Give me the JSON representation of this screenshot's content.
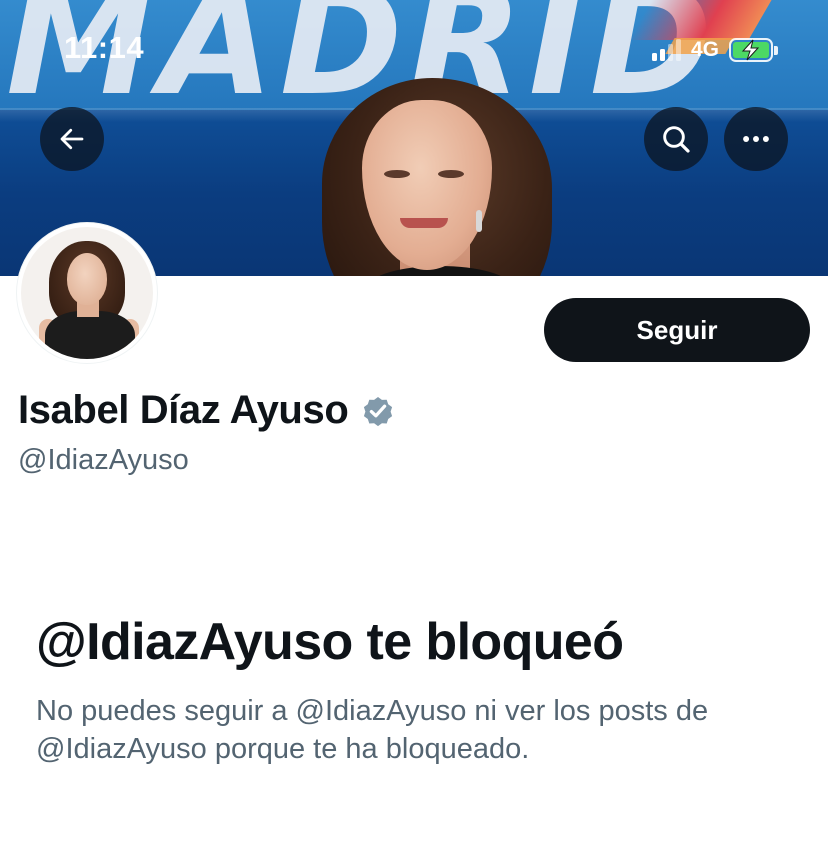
{
  "status_bar": {
    "time": "11:14",
    "network": "4G",
    "signal_bars_active": 2,
    "signal_bars_total": 4,
    "battery_charging": true,
    "battery_color": "#4cd964"
  },
  "banner": {
    "sign_text": "MADRID",
    "colors": {
      "blue_top": "#2f86c9",
      "blue_bottom": "#0a3675"
    }
  },
  "nav": {
    "back_icon": "arrow-left-icon",
    "search_icon": "search-icon",
    "more_icon": "more-horizontal-icon"
  },
  "profile": {
    "display_name": "Isabel Díaz Ayuso",
    "verified_icon": "verified-badge-icon",
    "verified_color": "#829aab",
    "handle": "@IdiazAyuso",
    "follow_label": "Seguir"
  },
  "blocked": {
    "title": "@IdiazAyuso te bloqueó",
    "description": "No puedes seguir a @IdiazAyuso ni ver los posts de @IdiazAyuso porque te ha bloqueado."
  },
  "theme": {
    "text_primary": "#0f1419",
    "text_secondary": "#536471",
    "button_bg": "#0f1419",
    "button_text": "#ffffff"
  }
}
